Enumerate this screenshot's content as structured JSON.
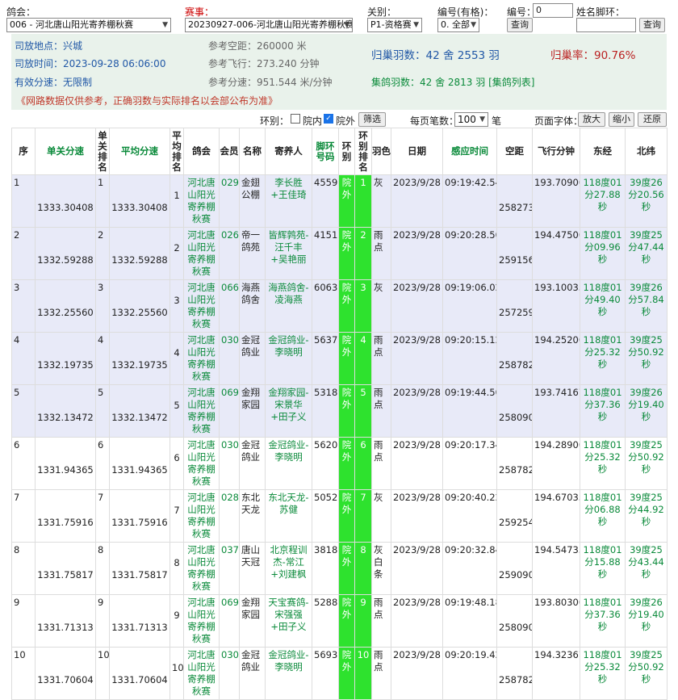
{
  "filters": {
    "club_label": "鸽会：",
    "club_value": "006 - 河北唐山阳光寄养棚秋赛",
    "race_label": "赛事：",
    "race_value": "20230927-006-河北唐山阳光寄养棚秋赛",
    "stage_label": "关别：",
    "stage_value": "P1-资格赛",
    "number_label": "编号(有格)：",
    "number_value": "0. 全部",
    "id_label": "编号：",
    "id_value": "0",
    "name_label": "姓名脚环：",
    "name_value": "",
    "query_label": "查询"
  },
  "info": {
    "location": "司放地点：兴城",
    "release_time": "司放时间：2023-09-28 06:06:00",
    "speed_limit": "有效分速：无限制",
    "ref_distance": "参考空距：260000 米",
    "ref_flight": "参考飞行：273.240 分钟",
    "ref_speed": "参考分速：951.544 米/分钟",
    "home_count": "归巢羽数：42 舍 2553 羽",
    "home_rate": "归巢率：90.76%",
    "collect_count": "集鸽羽数：42 舍 2813 羽 [集鸽列表]"
  },
  "notice": "《网路数据仅供参考，正确羽数与实际排名以会部公布为准》",
  "controls": {
    "ring_label": "环别：",
    "indoor_label": "院内",
    "outdoor_label": "院外",
    "filter_button": "筛选",
    "page_label": "每页笔数：",
    "page_value": "100",
    "page_unit": "笔",
    "font_label": "页面字体：",
    "zoom_in": "放大",
    "zoom_out": "缩小",
    "reset": "还原"
  },
  "table": {
    "headers": [
      "序",
      "单关分速",
      "单关排名",
      "平均分速",
      "平均排名",
      "鸽会",
      "会员",
      "名称",
      "寄养人",
      "脚环号码",
      "环别",
      "环别排名",
      "羽色",
      "日期",
      "感应时间",
      "空距",
      "飞行分钟",
      "东经",
      "北纬"
    ],
    "rows": [
      {
        "seq": "1",
        "speed": "1333.30408",
        "rank": "1",
        "avg_speed": "1333.30408",
        "avg_rank": "1",
        "club": "河北唐山阳光寄养棚秋赛",
        "member": "029",
        "name": "金翅公棚",
        "owner": "李长胜+王佳琦",
        "ring": "4559",
        "ring_type": "院外",
        "ring_rank": "1",
        "color": "灰",
        "date": "2023/9/28",
        "time": "09:19:42.54",
        "distance": "258273",
        "minutes": "193.70900",
        "lon": "118度01分27.88秒",
        "lat": "39度26分20.56秒"
      },
      {
        "seq": "2",
        "speed": "1332.59288",
        "rank": "2",
        "avg_speed": "1332.59288",
        "avg_rank": "2",
        "club": "河北唐山阳光寄养棚秋赛",
        "member": "026",
        "name": "帝一鸽苑",
        "owner": "皆辉鹑苑-汪千丰+吴艳丽",
        "ring": "4151",
        "ring_type": "院外",
        "ring_rank": "2",
        "color": "雨点",
        "date": "2023/9/28",
        "time": "09:20:28.50",
        "distance": "259156",
        "minutes": "194.47500",
        "lon": "118度01分09.96秒",
        "lat": "39度25分47.44秒"
      },
      {
        "seq": "3",
        "speed": "1332.25560",
        "rank": "3",
        "avg_speed": "1332.25560",
        "avg_rank": "3",
        "club": "河北唐山阳光寄养棚秋赛",
        "member": "066",
        "name": "海燕鸽舍",
        "owner": "海燕鸽舍-凌海燕",
        "ring": "6063",
        "ring_type": "院外",
        "ring_rank": "3",
        "color": "灰",
        "date": "2023/9/28",
        "time": "09:19:06.02",
        "distance": "257259",
        "minutes": "193.10033",
        "lon": "118度01分49.40秒",
        "lat": "39度26分57.84秒"
      },
      {
        "seq": "4",
        "speed": "1332.19735",
        "rank": "4",
        "avg_speed": "1332.19735",
        "avg_rank": "4",
        "club": "河北唐山阳光寄养棚秋赛",
        "member": "030",
        "name": "金冠鸽业",
        "owner": "金冠鸽业-李晓明",
        "ring": "5637",
        "ring_type": "院外",
        "ring_rank": "4",
        "color": "雨点",
        "date": "2023/9/28",
        "time": "09:20:15.12",
        "distance": "258782",
        "minutes": "194.25200",
        "lon": "118度01分25.32秒",
        "lat": "39度25分50.92秒"
      },
      {
        "seq": "5",
        "speed": "1332.13472",
        "rank": "5",
        "avg_speed": "1332.13472",
        "avg_rank": "5",
        "club": "河北唐山阳光寄养棚秋赛",
        "member": "069",
        "name": "金翔家园",
        "owner": "金翔家园-宋景华+田子义",
        "ring": "5318",
        "ring_type": "院外",
        "ring_rank": "5",
        "color": "雨点",
        "date": "2023/9/28",
        "time": "09:19:44.50",
        "distance": "258090",
        "minutes": "193.74167",
        "lon": "118度01分37.36秒",
        "lat": "39度26分19.40秒"
      },
      {
        "seq": "6",
        "speed": "1331.94365",
        "rank": "6",
        "avg_speed": "1331.94365",
        "avg_rank": "6",
        "club": "河北唐山阳光寄养棚秋赛",
        "member": "030",
        "name": "金冠鸽业",
        "owner": "金冠鸽业-李晓明",
        "ring": "5620",
        "ring_type": "院外",
        "ring_rank": "6",
        "color": "雨点",
        "date": "2023/9/28",
        "time": "09:20:17.34",
        "distance": "258782",
        "minutes": "194.28900",
        "lon": "118度01分25.32秒",
        "lat": "39度25分50.92秒"
      },
      {
        "seq": "7",
        "speed": "1331.75916",
        "rank": "7",
        "avg_speed": "1331.75916",
        "avg_rank": "7",
        "club": "河北唐山阳光寄养棚秋赛",
        "member": "028",
        "name": "东北天龙",
        "owner": "东北天龙-苏健",
        "ring": "5052",
        "ring_type": "院外",
        "ring_rank": "7",
        "color": "灰",
        "date": "2023/9/28",
        "time": "09:20:40.22",
        "distance": "259254",
        "minutes": "194.67033",
        "lon": "118度01分06.88秒",
        "lat": "39度25分44.92秒"
      },
      {
        "seq": "8",
        "speed": "1331.75817",
        "rank": "8",
        "avg_speed": "1331.75817",
        "avg_rank": "8",
        "club": "河北唐山阳光寄养棚秋赛",
        "member": "037",
        "name": "唐山天冠",
        "owner": "北京程训杰-常江+刘建枫",
        "ring": "3818",
        "ring_type": "院外",
        "ring_rank": "8",
        "color": "灰白条",
        "date": "2023/9/28",
        "time": "09:20:32.84",
        "distance": "259090",
        "minutes": "194.54733",
        "lon": "118度01分15.88秒",
        "lat": "39度25分43.44秒"
      },
      {
        "seq": "9",
        "speed": "1331.71313",
        "rank": "9",
        "avg_speed": "1331.71313",
        "avg_rank": "9",
        "club": "河北唐山阳光寄养棚秋赛",
        "member": "069",
        "name": "金翔家园",
        "owner": "天宝赛鸽-宋强强+田子义",
        "ring": "5288",
        "ring_type": "院外",
        "ring_rank": "9",
        "color": "雨点",
        "date": "2023/9/28",
        "time": "09:19:48.18",
        "distance": "258090",
        "minutes": "193.80300",
        "lon": "118度01分37.36秒",
        "lat": "39度26分19.40秒"
      },
      {
        "seq": "10",
        "speed": "1331.70604",
        "rank": "10",
        "avg_speed": "1331.70604",
        "avg_rank": "10",
        "club": "河北唐山阳光寄养棚秋赛",
        "member": "030",
        "name": "金冠鸽业",
        "owner": "金冠鸽业-李晓明",
        "ring": "5693",
        "ring_type": "院外",
        "ring_rank": "10",
        "color": "雨点",
        "date": "2023/9/28",
        "time": "09:20:19.42",
        "distance": "258782",
        "minutes": "194.32367",
        "lon": "118度01分25.32秒",
        "lat": "39度25分50.92秒"
      }
    ]
  }
}
